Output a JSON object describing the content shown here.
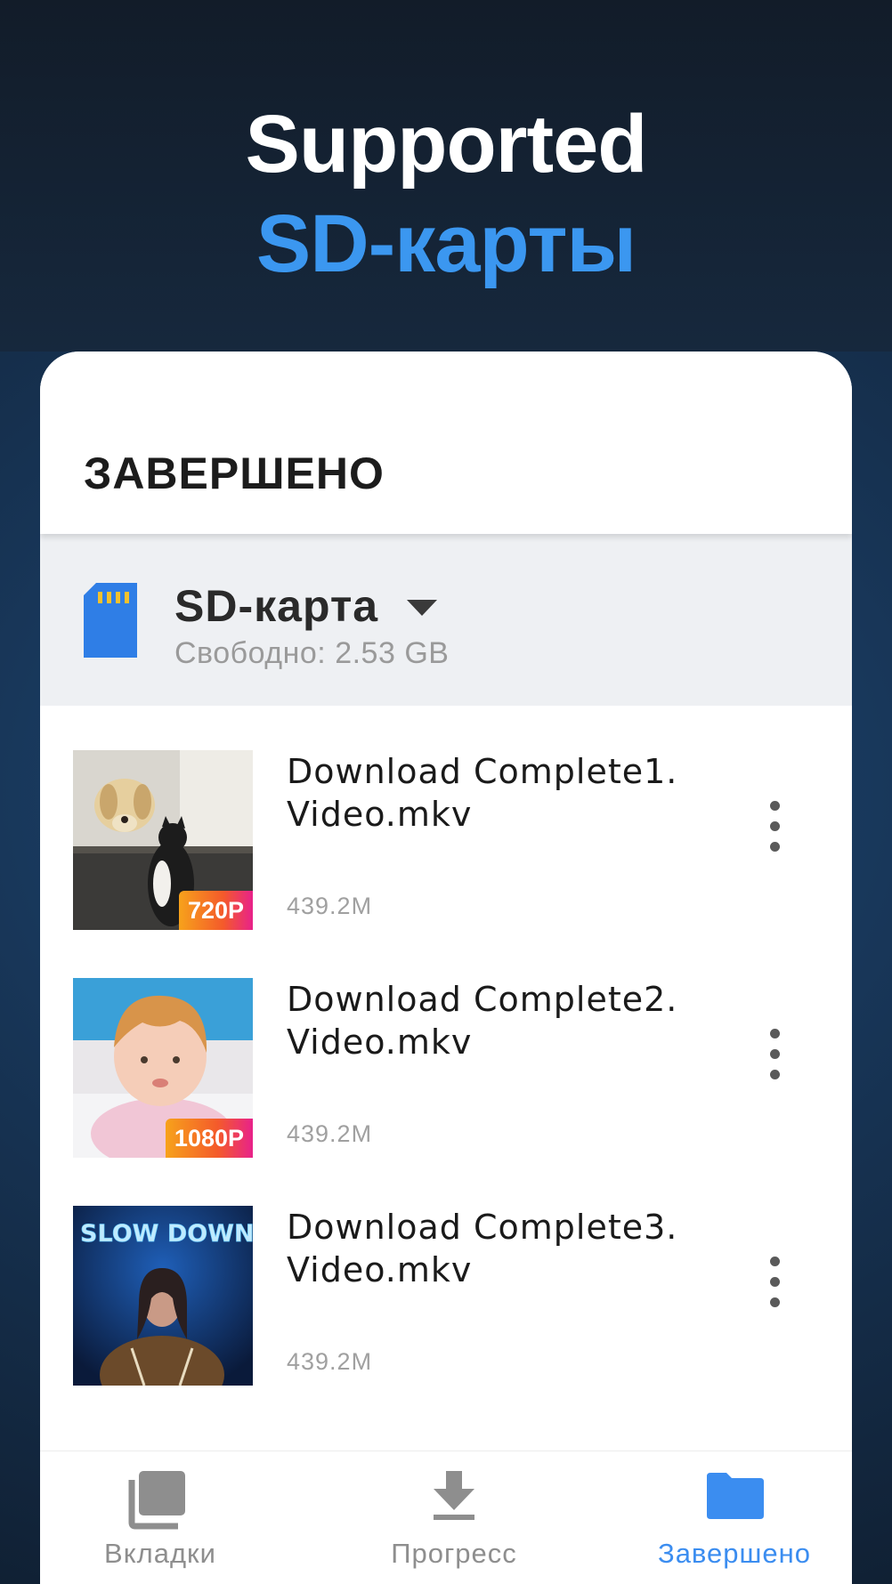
{
  "hero": {
    "line1": "Supported",
    "line2": "SD-карты"
  },
  "card": {
    "title": "ЗАВЕРШЕНО"
  },
  "storage": {
    "name": "SD-карта",
    "free": "Свободно: 2.53 GB",
    "icon": "sd-card-icon"
  },
  "downloads": [
    {
      "title_line1": "Download Complete1.",
      "title_line2": "Video.mkv",
      "size": "439.2M",
      "quality": "720P"
    },
    {
      "title_line1": "Download Complete2.",
      "title_line2": "Video.mkv",
      "size": "439.2M",
      "quality": "1080P"
    },
    {
      "title_line1": "Download Complete3.",
      "title_line2": "Video.mkv",
      "size": "439.2M",
      "quality": ""
    }
  ],
  "nav": {
    "tabs_label": "Вкладки",
    "progress_label": "Прогресс",
    "done_label": "Завершено",
    "active": "done"
  },
  "colors": {
    "accent": "#3b97f0",
    "sd_icon": "#2f7ee6",
    "nav_active": "#3b8df0",
    "nav_inactive": "#8e8e8e"
  }
}
